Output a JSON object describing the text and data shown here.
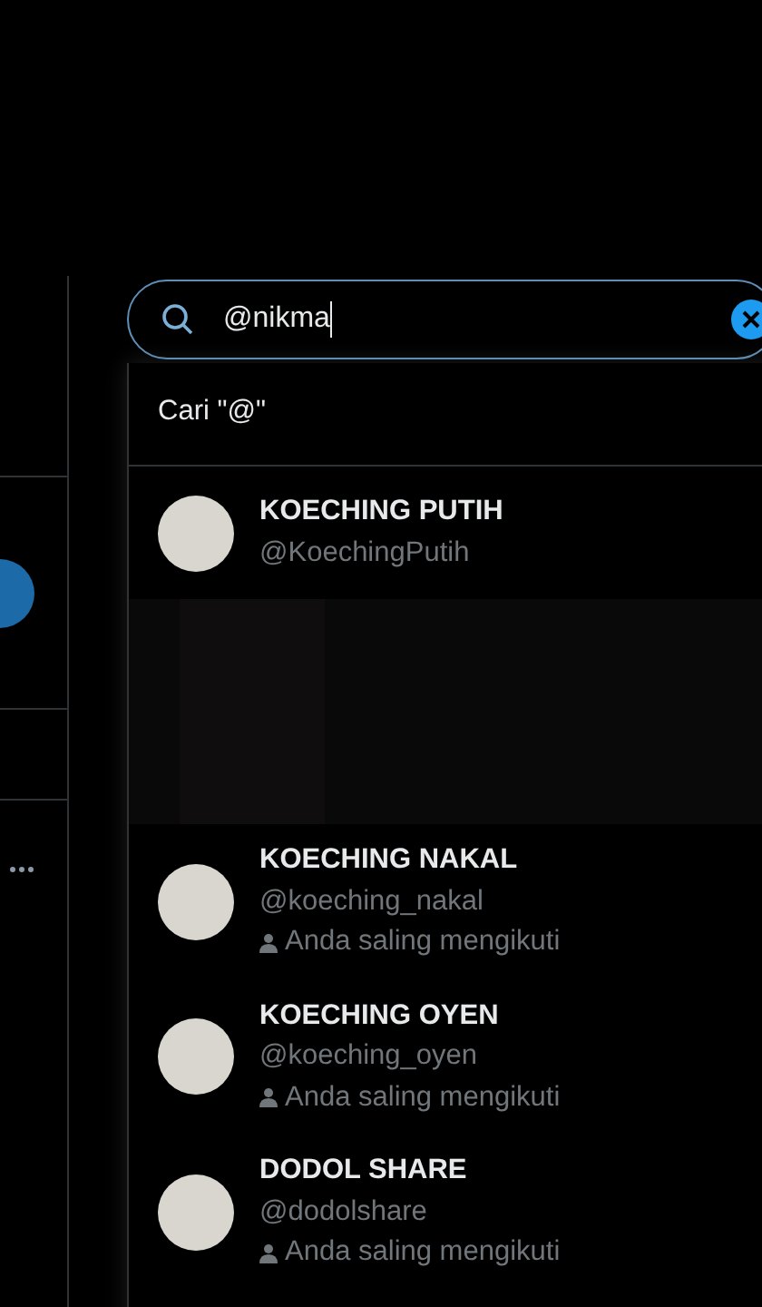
{
  "search": {
    "value": "@nikma"
  },
  "dropdown": {
    "search_hint": "Cari \"@\"",
    "users": [
      {
        "kind": "user",
        "name": "KOECHING PUTIH",
        "handle": "@KoechingPutih"
      },
      {
        "kind": "obscured"
      },
      {
        "kind": "user",
        "name": "KOECHING NAKAL",
        "handle": "@koeching_nakal",
        "note": "Anda saling mengikuti"
      },
      {
        "kind": "user",
        "name": "KOECHING OYEN",
        "handle": "@koeching_oyen",
        "note": "Anda saling mengikuti"
      },
      {
        "kind": "user",
        "name": "DODOL SHARE",
        "handle": "@dodolshare",
        "note": "Anda saling mengikuti"
      }
    ]
  }
}
